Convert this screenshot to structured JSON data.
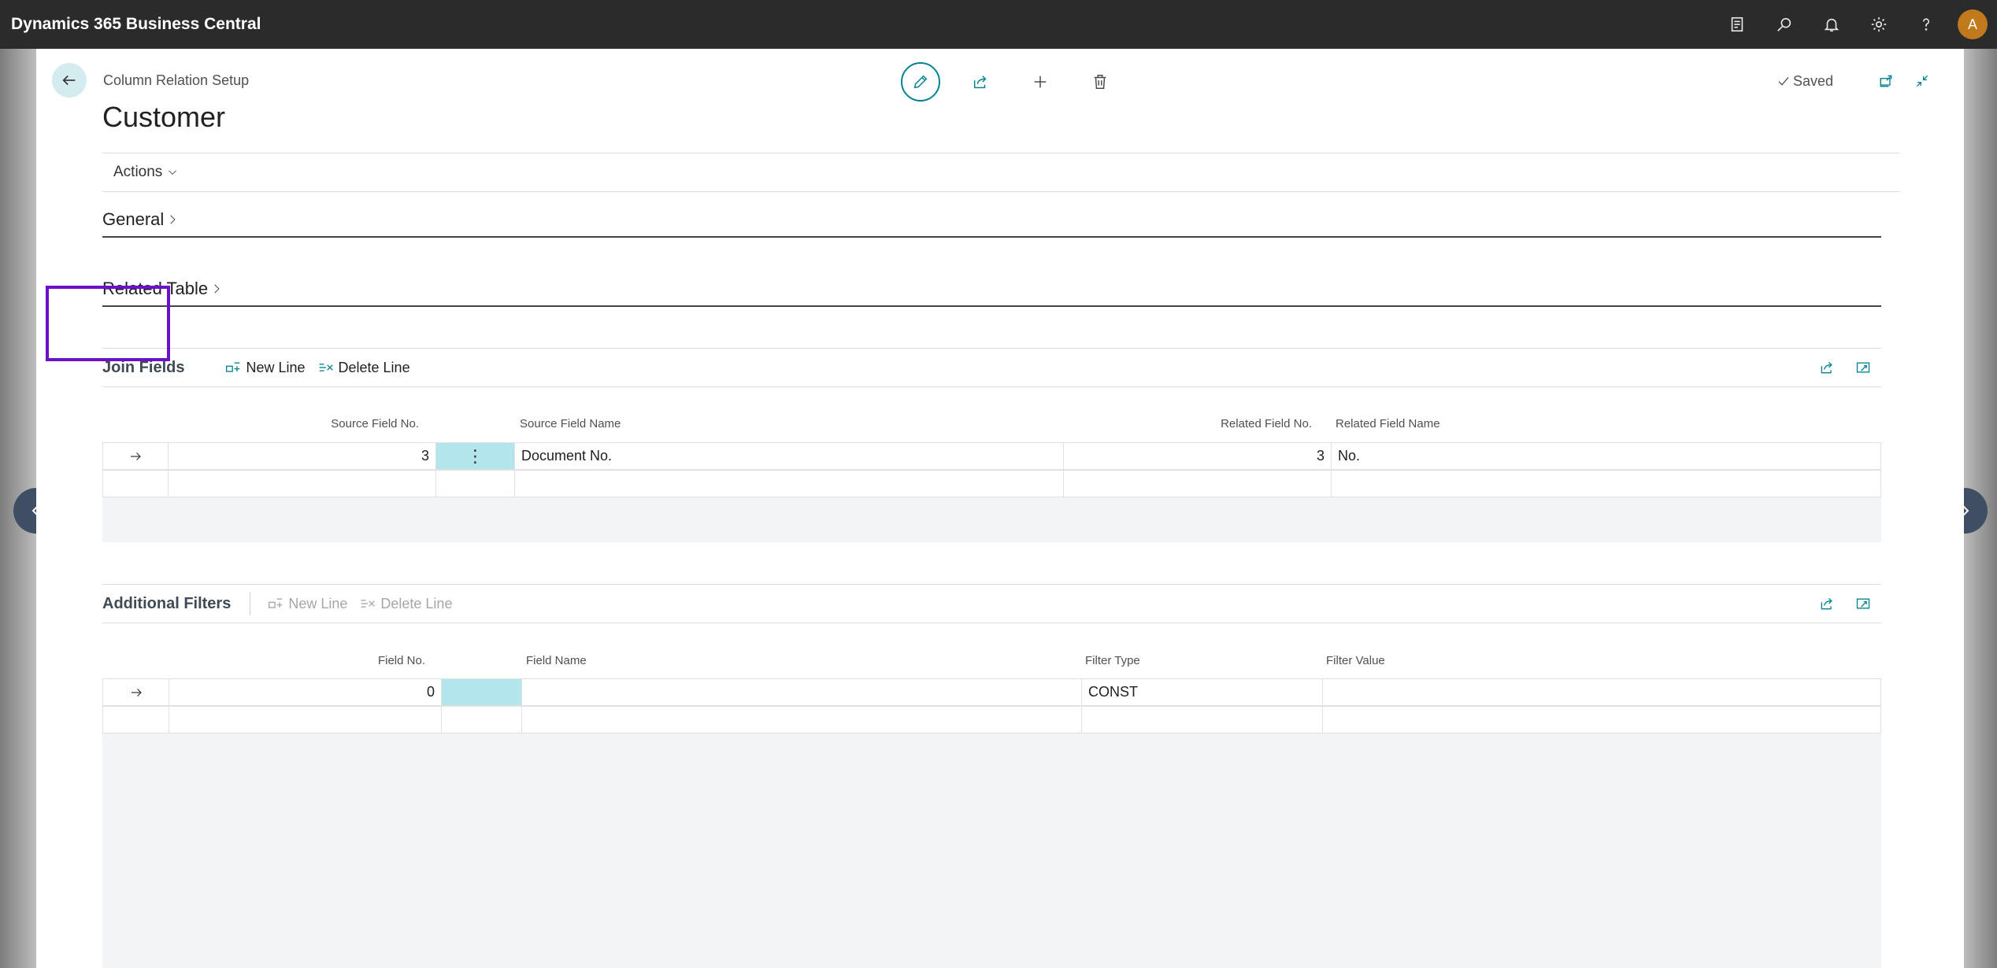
{
  "app": {
    "title": "Dynamics 365 Business Central",
    "avatar_initial": "A"
  },
  "topbar_icons": [
    "document-icon",
    "search-icon",
    "bell-icon",
    "gear-icon",
    "help-icon"
  ],
  "page": {
    "breadcrumb": "Column Relation Setup",
    "title": "Customer",
    "saved_label": "Saved",
    "actions_label": "Actions"
  },
  "sections": {
    "general": "General",
    "related_table": "Related Table"
  },
  "join_fields": {
    "title": "Join Fields",
    "new_line": "New Line",
    "delete_line": "Delete Line",
    "columns": [
      "Source Field No.",
      "Source Field Name",
      "Related Field No.",
      "Related Field Name"
    ],
    "rows": [
      {
        "source_field_no": "3",
        "source_field_name": "Document No.",
        "related_field_no": "3",
        "related_field_name": "No."
      }
    ]
  },
  "additional_filters": {
    "title": "Additional Filters",
    "new_line": "New Line",
    "delete_line": "Delete Line",
    "columns": [
      "Field No.",
      "Field Name",
      "Filter Type",
      "Filter Value"
    ],
    "rows": [
      {
        "field_no": "0",
        "field_name": "",
        "filter_type": "CONST",
        "filter_value": ""
      }
    ]
  },
  "colors": {
    "accent": "#00838f",
    "highlight": "#6a12c8",
    "selected_cell": "#b3e5ec",
    "topbar": "#2b2b2b"
  }
}
